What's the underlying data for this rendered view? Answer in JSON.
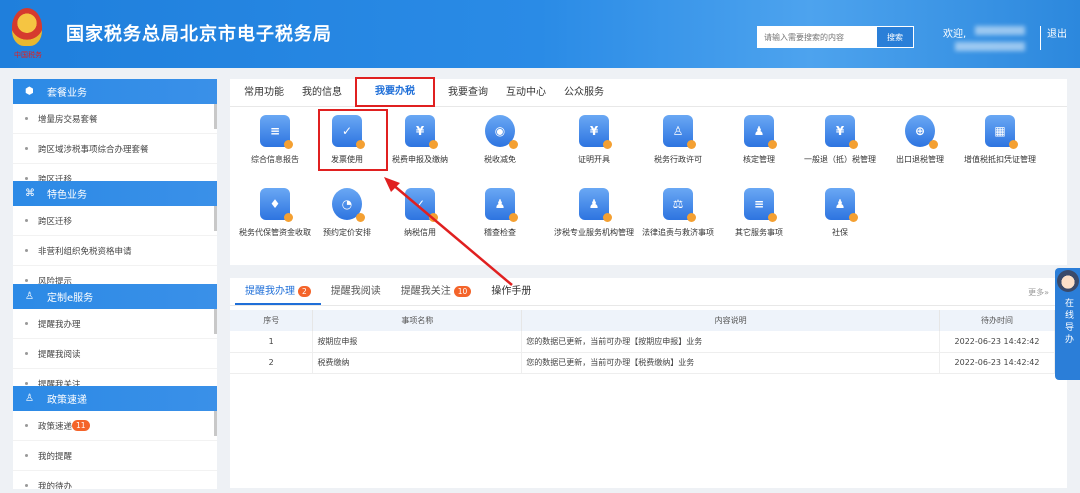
{
  "header": {
    "emblem_text": "中国税务",
    "title": "国家税务总局北京市电子税务局",
    "search_placeholder": "请输入需要搜索的内容",
    "search_button": "搜索",
    "welcome": "欢迎,",
    "logout": "退出"
  },
  "sidebar": [
    {
      "title": "套餐业务",
      "icon": "cube-icon",
      "items": [
        "增量房交易套餐",
        "跨区域涉税事项综合办理套餐",
        "跨区迁移"
      ]
    },
    {
      "title": "特色业务",
      "icon": "grid-icon",
      "items": [
        "跨区迁移",
        "非营利组织免税资格申请",
        "风险提示"
      ]
    },
    {
      "title": "定制e服务",
      "icon": "user-icon",
      "items": [
        "提醒我办理",
        "提醒我阅读",
        "提醒我关注"
      ]
    },
    {
      "title": "政策速递",
      "icon": "user-icon",
      "items": [
        "政策速递",
        "我的提醒",
        "我的待办"
      ],
      "badge": "11"
    }
  ],
  "main": {
    "tabs": [
      "常用功能",
      "我的信息",
      "我要办税",
      "我要查询",
      "互动中心",
      "公众服务"
    ],
    "active_tab": "我要办税",
    "functions": [
      {
        "label": "综合信息报告",
        "glyph": "≡"
      },
      {
        "label": "发票使用",
        "glyph": "✓"
      },
      {
        "label": "税费申报及缴纳",
        "glyph": "¥"
      },
      {
        "label": "税收减免",
        "glyph": "◉"
      },
      {
        "label": "证明开具",
        "glyph": "¥"
      },
      {
        "label": "税务行政许可",
        "glyph": "♙"
      },
      {
        "label": "核定管理",
        "glyph": "♟"
      },
      {
        "label": "一般退（抵）税管理",
        "glyph": "¥"
      },
      {
        "label": "出口退税管理",
        "glyph": "⊕"
      },
      {
        "label": "增值税抵扣凭证管理",
        "glyph": "▦"
      },
      {
        "label": "税务代保管资金收取",
        "glyph": "♦"
      },
      {
        "label": "预约定价安排",
        "glyph": "◔"
      },
      {
        "label": "纳税信用",
        "glyph": "✓"
      },
      {
        "label": "稽查检查",
        "glyph": "♟"
      },
      {
        "label": "涉税专业服务机构管理",
        "glyph": "♟"
      },
      {
        "label": "法律追责与救济事项",
        "glyph": "⚖"
      },
      {
        "label": "其它服务事项",
        "glyph": "≡"
      },
      {
        "label": "社保",
        "glyph": "♟"
      }
    ]
  },
  "reminders": {
    "tabs": [
      {
        "label": "提醒我办理",
        "badge": "2"
      },
      {
        "label": "提醒我阅读"
      },
      {
        "label": "提醒我关注",
        "badge": "10"
      },
      {
        "label": "操作手册"
      }
    ],
    "more": "更多»",
    "columns": [
      "序号",
      "事项名称",
      "内容说明",
      "待办时间"
    ],
    "rows": [
      [
        "1",
        "按期应申报",
        "您的数据已更新，当前可办理【按期应申报】业务",
        "2022-06-23 14:42:42"
      ],
      [
        "2",
        "税费缴纳",
        "您的数据已更新，当前可办理【税费缴纳】业务",
        "2022-06-23 14:42:42"
      ]
    ]
  },
  "float_button": "在线导办"
}
